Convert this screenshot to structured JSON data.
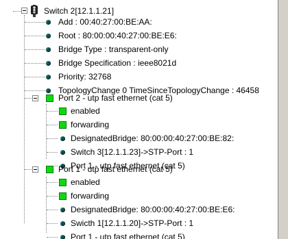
{
  "colors": {
    "status_green": "#10d810",
    "bullet": "#0f4f4f",
    "connector": "#808080"
  },
  "root": {
    "label": "Switch 2[12.1.1.21]",
    "icon": "traffic-light-icon",
    "properties": [
      "Add : 00:40:27:00:BE:AA:",
      "Root : 80:00:00:40:27:00:BE:E6:",
      "Bridge Type : transparent-only",
      "Bridge Specification : ieee8021d",
      "Priority: 32768",
      "TopologyChange 0 TimeSinceTopologyChange : 46458"
    ],
    "ports": [
      {
        "label": "Port 2 - utp fast ethernet (cat 5)",
        "status": [
          "enabled",
          "forwarding"
        ],
        "details": [
          "DesignatedBridge: 80:00:00:40:27:00:BE:82:",
          "Switch 3[12.1.1.23]->STP-Port : 1",
          "Port 1 - utp fast ethernet (cat 5)"
        ]
      },
      {
        "label": "Port 1 - utp fast ethernet (cat 5)",
        "status": [
          "enabled",
          "forwarding"
        ],
        "details": [
          "DesignatedBridge: 80:00:00:40:27:00:BE:E6:",
          "Swicth 1[12.1.1.20]->STP-Port : 1",
          "Port 1 - utp fast ethernet (cat 5)"
        ]
      }
    ]
  }
}
